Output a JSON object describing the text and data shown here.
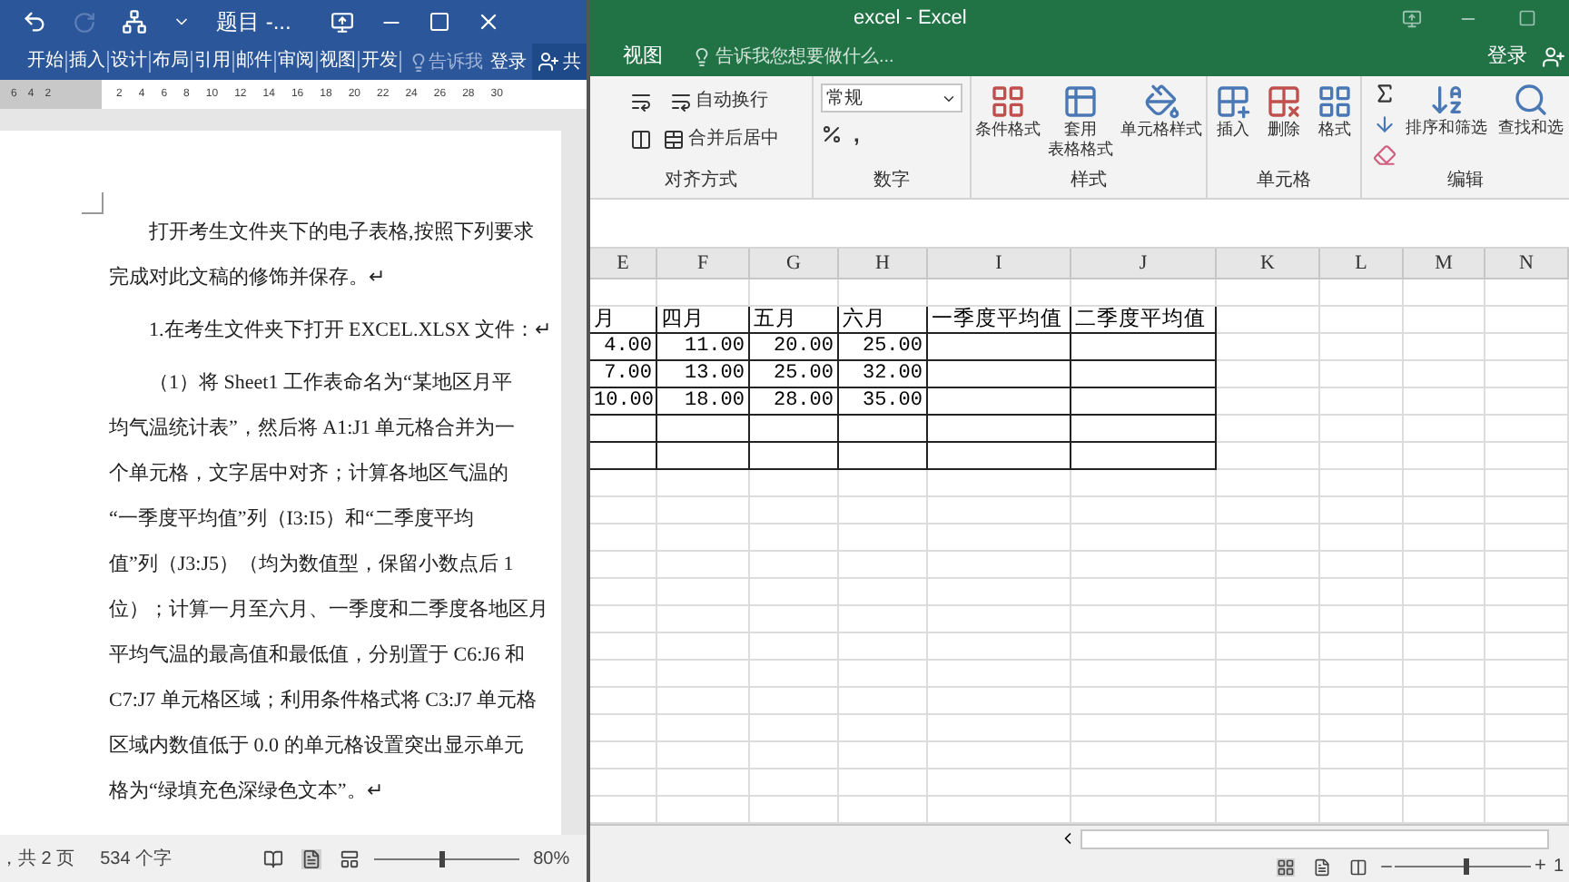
{
  "word": {
    "title": "题目 -...",
    "tabs": [
      "开始",
      "插入",
      "设计",
      "布局",
      "引用",
      "邮件",
      "审阅",
      "视图",
      "开发"
    ],
    "tell_me": "告诉我",
    "sign_in": "登录",
    "share": "共",
    "ruler_marks": [
      "6",
      "4",
      "2",
      "2",
      "4",
      "6",
      "8",
      "10",
      "12",
      "14",
      "16",
      "18",
      "20",
      "22",
      "24",
      "26",
      "28",
      "30"
    ],
    "paragraphs": [
      {
        "lines": [
          "打开考生文件夹下的电子表格,按照下列要求",
          "完成对此文稿的修饰并保存。↵"
        ]
      },
      {
        "lines": [
          "1.在考生文件夹下打开 EXCEL.XLSX 文件：↵"
        ]
      },
      {
        "lines": [
          "（1）将 Sheet1 工作表命名为“某地区月平",
          "均气温统计表”，然后将 A1:J1 单元格合并为一",
          "个单元格，文字居中对齐；计算各地区气温的",
          "“一季度平均值”列（I3:I5）和“二季度平均",
          "值”列（J3:J5）（均为数值型，保留小数点后 1",
          "位）；计算一月至六月、一季度和二季度各地区月",
          "平均气温的最高值和最低值，分别置于 C6:J6 和",
          "C7:J7 单元格区域；利用条件格式将 C3:J7 单元格",
          "区域内数值低于 0.0 的单元格设置突出显示单元",
          "格为“绿填充色深绿色文本”。↵"
        ]
      }
    ],
    "status": {
      "pages": "，共 2 页",
      "words": "534 个字",
      "zoom": "80%",
      "zoom_slider": {
        "level": 0.45
      }
    }
  },
  "excel": {
    "title": "excel - Excel",
    "tab": "视图",
    "tell_me": "告诉我您想要做什么...",
    "sign_in": "登录",
    "ribbon": {
      "wrap_text": "自动换行",
      "merge_center": "合并后居中",
      "number_format": "常规",
      "comma": ",",
      "style_buttons": [
        {
          "lines": [
            "条件格式"
          ]
        },
        {
          "lines": [
            "套用",
            "表格格式"
          ]
        },
        {
          "lines": [
            "单元格样式"
          ]
        }
      ],
      "cell_buttons": [
        "插入",
        "删除",
        "格式"
      ],
      "edit_buttons": [
        "排序和筛选",
        "查找和选"
      ],
      "groups": [
        "对齐方式",
        "数字",
        "样式",
        "单元格",
        "编辑"
      ]
    },
    "columns": [
      "E",
      "F",
      "G",
      "H",
      "I",
      "J",
      "K",
      "L",
      "M",
      "N"
    ],
    "rows": [
      [
        "月",
        "四月",
        "五月",
        "六月",
        "一季度平均值",
        "二季度平均值"
      ],
      [
        "4.00",
        "11.00",
        "20.00",
        "25.00",
        "",
        ""
      ],
      [
        "7.00",
        "13.00",
        "25.00",
        "32.00",
        "",
        ""
      ],
      [
        "10.00",
        "18.00",
        "28.00",
        "35.00",
        "",
        ""
      ]
    ],
    "zoom_slider": {
      "level": 0.5
    },
    "zoom_in": "+",
    "zoom_label": "1"
  }
}
